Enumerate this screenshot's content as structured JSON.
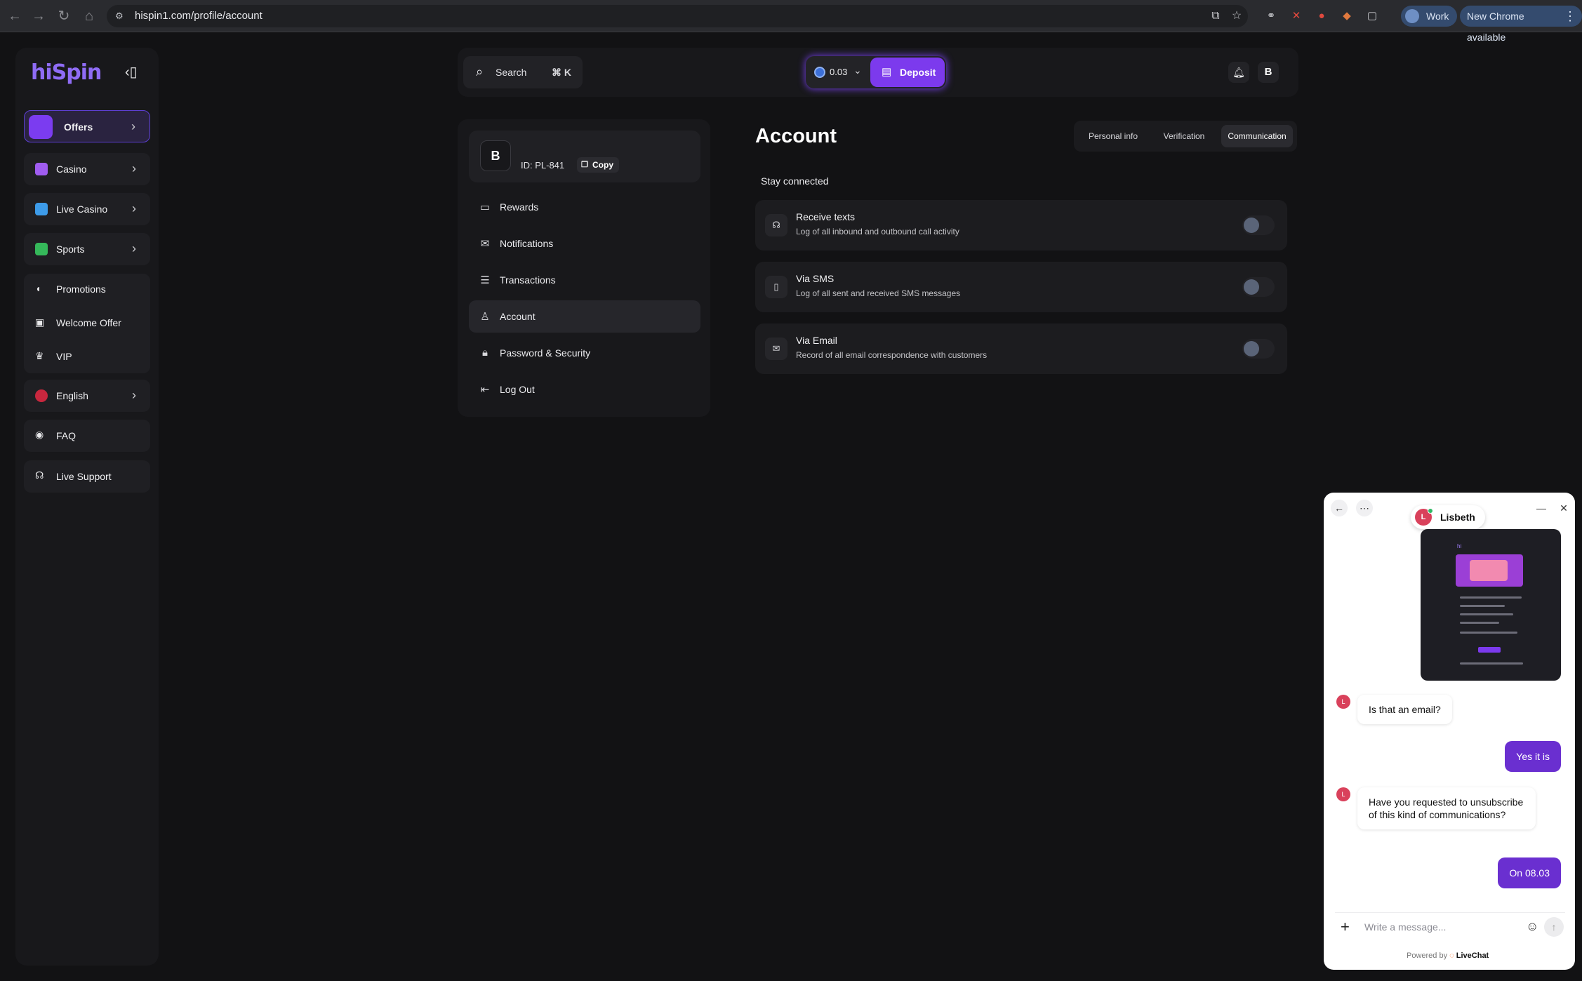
{
  "browser": {
    "url": "hispin1.com/profile/account",
    "profile_label": "Work",
    "update_label": "New Chrome available"
  },
  "sidebar": {
    "logo": "hiSpin",
    "items": [
      {
        "label": "Offers",
        "icon": "gift-box-icon",
        "color": "#7b3cf0"
      },
      {
        "label": "Casino",
        "icon": "casino-icon",
        "color": "#a05cf0"
      },
      {
        "label": "Live Casino",
        "icon": "live-casino-icon",
        "color": "#3d9be9"
      },
      {
        "label": "Sports",
        "icon": "sports-icon",
        "color": "#35b85a"
      }
    ],
    "group": [
      {
        "label": "Promotions",
        "icon": "megaphone-icon"
      },
      {
        "label": "Welcome Offer",
        "icon": "gift-icon"
      },
      {
        "label": "VIP",
        "icon": "crown-icon"
      }
    ],
    "language": "English",
    "faq": "FAQ",
    "support": "Live Support"
  },
  "header": {
    "search_label": "Search",
    "search_shortcut": "⌘ K",
    "balance": "0.03",
    "deposit_label": "Deposit",
    "avatar_initial": "B"
  },
  "profile": {
    "initial": "B",
    "id_label": "ID: PL-841",
    "copy_label": "Copy",
    "menu": [
      {
        "label": "Rewards",
        "icon": "wallet-icon"
      },
      {
        "label": "Notifications",
        "icon": "inbox-icon"
      },
      {
        "label": "Transactions",
        "icon": "receipt-icon"
      },
      {
        "label": "Account",
        "icon": "user-icon"
      },
      {
        "label": "Password & Security",
        "icon": "lock-icon"
      },
      {
        "label": "Log Out",
        "icon": "logout-icon"
      }
    ]
  },
  "account": {
    "title": "Account",
    "tabs": [
      "Personal info",
      "Verification",
      "Communication"
    ],
    "active_tab": "Communication",
    "section_label": "Stay connected",
    "settings": [
      {
        "title": "Receive texts",
        "desc": "Log of all inbound and outbound call activity",
        "icon": "headset-icon",
        "enabled": false
      },
      {
        "title": "Via SMS",
        "desc": "Log of all sent and received SMS messages",
        "icon": "phone-icon",
        "enabled": false
      },
      {
        "title": "Via Email",
        "desc": "Record of all email correspondence with customers",
        "icon": "envelope-icon",
        "enabled": false
      }
    ]
  },
  "chat": {
    "agent_name": "Lisbeth",
    "agent_initial": "L",
    "messages": [
      {
        "from": "agent",
        "text": "Is that an email?"
      },
      {
        "from": "user",
        "text": "Yes it is"
      },
      {
        "from": "agent",
        "text": "Have you requested to unsubscribe of this kind of communications?"
      },
      {
        "from": "user",
        "text": "On 08.03"
      }
    ],
    "input_placeholder": "Write a message...",
    "powered_prefix": "Powered by",
    "powered_brand": "LiveChat"
  }
}
